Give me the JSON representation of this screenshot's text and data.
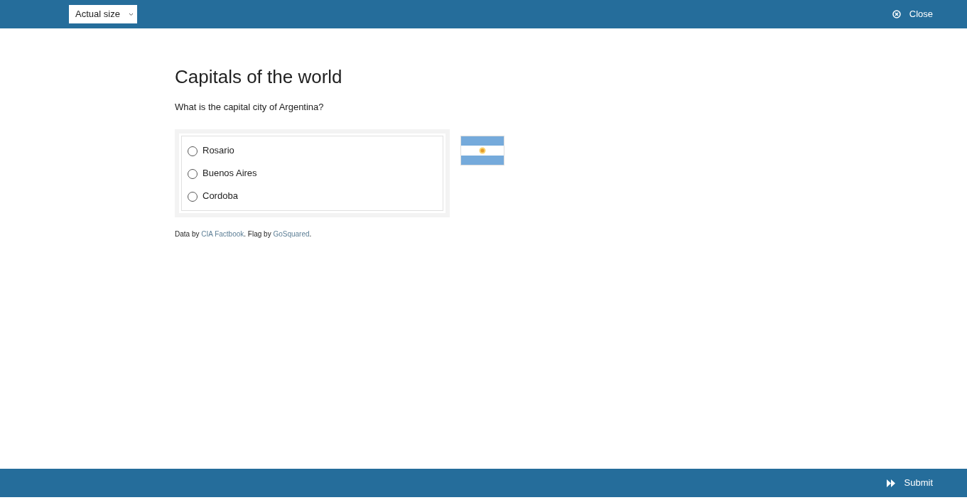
{
  "toolbar": {
    "zoom_select": "Actual size",
    "close": "Close"
  },
  "quiz": {
    "title": "Capitals of the world",
    "question": "What is the capital city of Argentina?",
    "options": [
      {
        "label": "Rosario",
        "selected": false
      },
      {
        "label": "Buenos Aires",
        "selected": false
      },
      {
        "label": "Cordoba",
        "selected": false
      }
    ],
    "credit": [
      {
        "kind": "text",
        "text": "Data by "
      },
      {
        "kind": "link",
        "text": "CIA Factbook"
      },
      {
        "kind": "text",
        "text": ". Flag by "
      },
      {
        "kind": "link",
        "text": "GoSquared"
      },
      {
        "kind": "text",
        "text": "."
      }
    ]
  },
  "footer": {
    "submit": "Submit"
  }
}
